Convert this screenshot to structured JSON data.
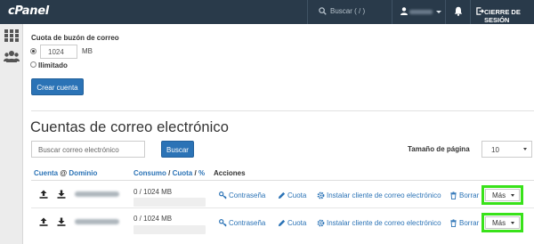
{
  "header": {
    "logo": "cPanel",
    "search_placeholder": "Buscar ( / )",
    "logout_label": "CIERRE DE SESIÓN"
  },
  "form": {
    "quota_label": "Cuota de buzón de correo",
    "quota_value": "1024",
    "quota_unit": "MB",
    "unlimited_label": "Ilimitado",
    "create_button": "Crear cuenta"
  },
  "accounts": {
    "title": "Cuentas de correo electrónico",
    "search_placeholder": "Buscar correo electrónico",
    "search_button": "Buscar",
    "page_size_label": "Tamaño de página",
    "page_size_value": "10",
    "columns": {
      "account": "Cuenta",
      "at": "@",
      "domain": "Dominio",
      "usage": "Consumo",
      "sep1": "/",
      "quota": "Cuota",
      "sep2": "/",
      "percent": "%",
      "actions": "Acciones"
    },
    "rows": [
      {
        "usage": "0 / 1024 MB",
        "usage_percent": 0
      },
      {
        "usage": "0 / 1024 MB",
        "usage_percent": 0
      }
    ],
    "actions": {
      "password": "Contraseña",
      "quota": "Cuota",
      "install_client": "Instalar cliente de correo electrónico",
      "delete": "Borrar",
      "more": "Más"
    }
  },
  "colors": {
    "topbar": "#293a4a",
    "primary": "#2b73b6",
    "highlight": "#39e21a"
  },
  "icons": [
    "search-icon",
    "user-icon",
    "bell-icon",
    "logout-icon",
    "grid-icon",
    "users-icon",
    "upload-icon",
    "download-icon",
    "key-icon",
    "pencil-icon",
    "gear-icon",
    "trash-icon"
  ]
}
